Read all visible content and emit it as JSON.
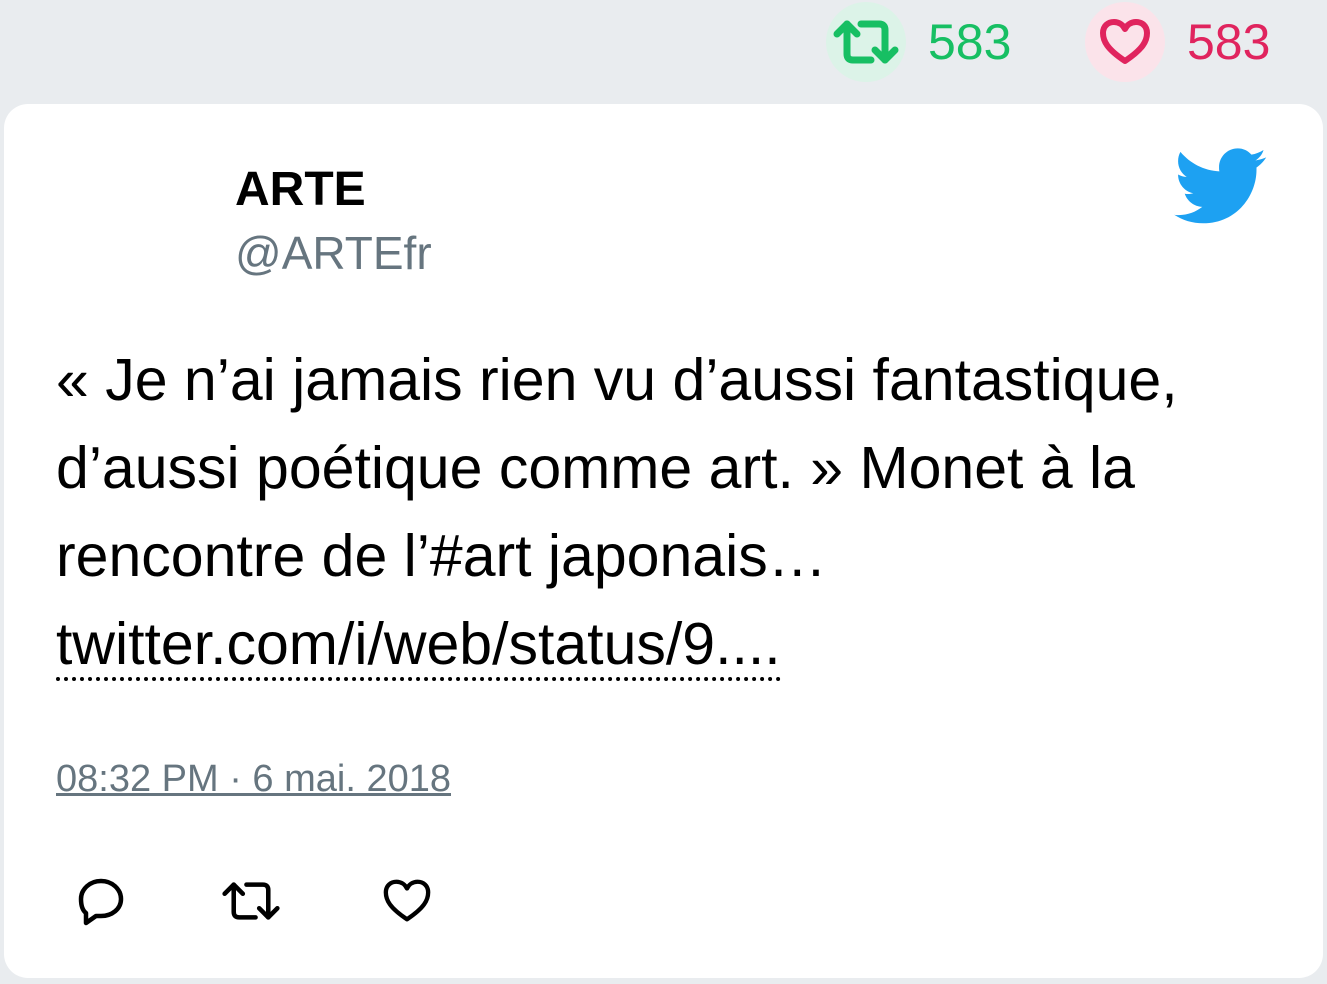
{
  "stats": {
    "retweet_count": "583",
    "like_count": "583"
  },
  "tweet": {
    "author_name": "ARTE",
    "author_handle": "@ARTEfr",
    "text": "« Je n’ai jamais rien vu d’aussi fantastique, d’aussi poétique comme art. » Monet à la rencontre de l’#art japonais… ",
    "link_text": "twitter.com/i/web/status/9....",
    "timestamp": "08:32 PM · 6 mai. 2018"
  },
  "icons": {
    "stats_retweet": "retweet-icon",
    "stats_like": "heart-icon",
    "logo": "twitter-bird-icon",
    "reply": "reply-icon",
    "retweet": "retweet-icon",
    "like": "heart-icon"
  },
  "colors": {
    "retweet": "#17bf63",
    "like": "#e0245e",
    "twitter_blue": "#1da1f2",
    "muted": "#66757f"
  }
}
